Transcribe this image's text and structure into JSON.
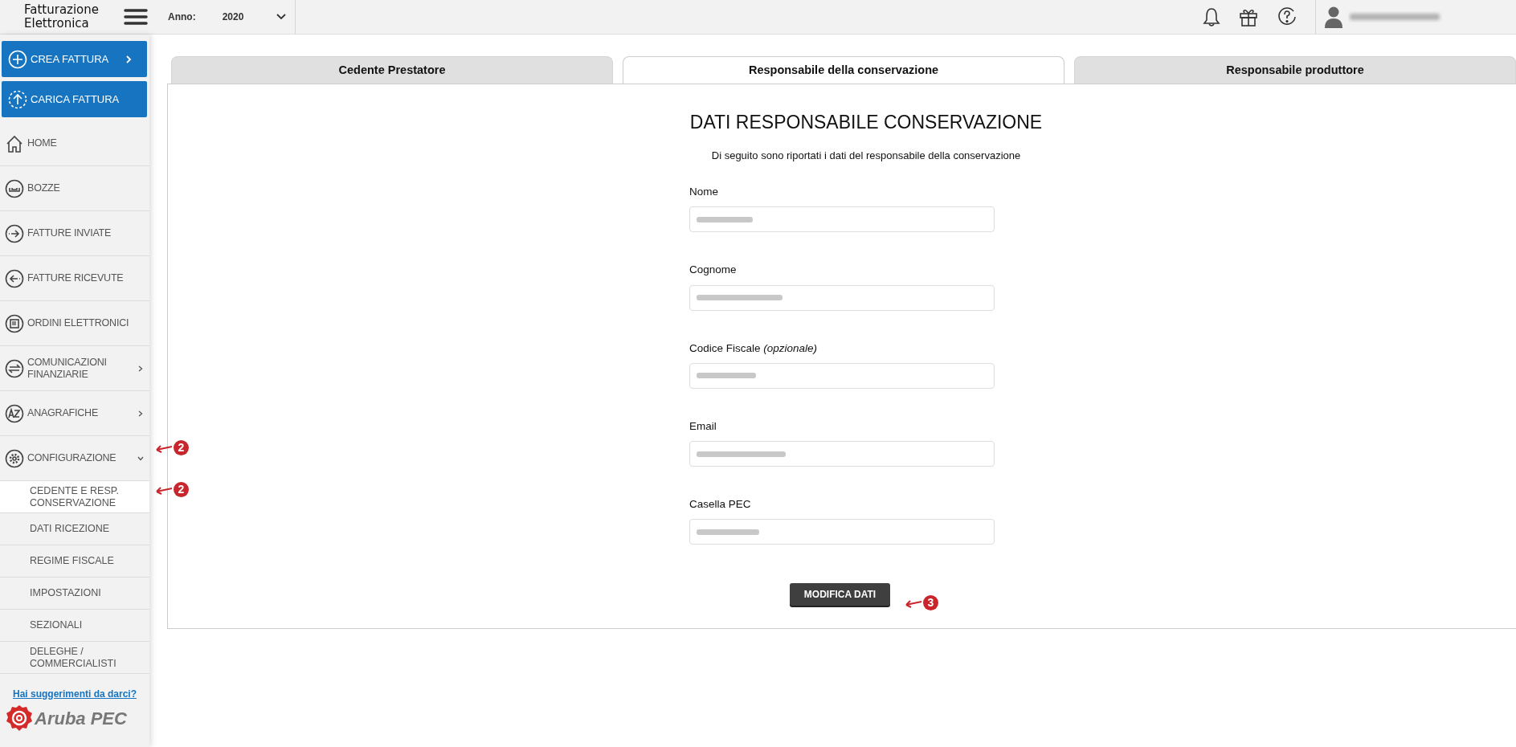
{
  "header": {
    "app_title_line1": "Fatturazione",
    "app_title_line2": "Elettronica",
    "year_label": "Anno:",
    "year_value": "2020"
  },
  "sidebar": {
    "actions": [
      {
        "label": "CREA FATTURA",
        "has_menu": true
      },
      {
        "label": "CARICA FATTURA",
        "has_menu": false
      }
    ],
    "items": [
      {
        "label": "HOME"
      },
      {
        "label": "BOZZE"
      },
      {
        "label": "FATTURE INVIATE"
      },
      {
        "label": "FATTURE RICEVUTE"
      },
      {
        "label": "ORDINI ELETTRONICI"
      },
      {
        "label": "COMUNICAZIONI FINANZIARIE",
        "expanded": false
      },
      {
        "label": "ANAGRAFICHE",
        "expanded": false
      },
      {
        "label": "CONFIGURAZIONE",
        "expanded": true,
        "children": [
          {
            "label": "CEDENTE E RESP. CONSERVAZIONE",
            "selected": true
          },
          {
            "label": "DATI RICEZIONE",
            "selected": false
          },
          {
            "label": "REGIME FISCALE",
            "selected": false
          },
          {
            "label": "IMPOSTAZIONI",
            "selected": false
          },
          {
            "label": "SEZIONALI",
            "selected": false
          },
          {
            "label": "DELEGHE / COMMERCIALISTI",
            "selected": false
          }
        ]
      }
    ],
    "feedback_link": "Hai suggerimenti da darci?",
    "brand": "Aruba PEC"
  },
  "tabs": [
    {
      "label": "Cedente Prestatore",
      "selected": false
    },
    {
      "label": "Responsabile della conservazione",
      "selected": true
    },
    {
      "label": "Responsabile produttore",
      "selected": false
    }
  ],
  "form": {
    "title": "DATI RESPONSABILE CONSERVAZIONE",
    "subtitle": "Di seguito sono riportati i dati del responsabile della conservazione",
    "fields": [
      {
        "label": "Nome"
      },
      {
        "label": "Cognome"
      },
      {
        "label": "Codice Fiscale *(opzionale)*"
      },
      {
        "label": "Email"
      },
      {
        "label": "Casella PEC"
      }
    ],
    "button": "MODIFICA DATI"
  },
  "callouts": [
    {
      "number": "2"
    },
    {
      "number": "2"
    },
    {
      "number": "3"
    }
  ]
}
